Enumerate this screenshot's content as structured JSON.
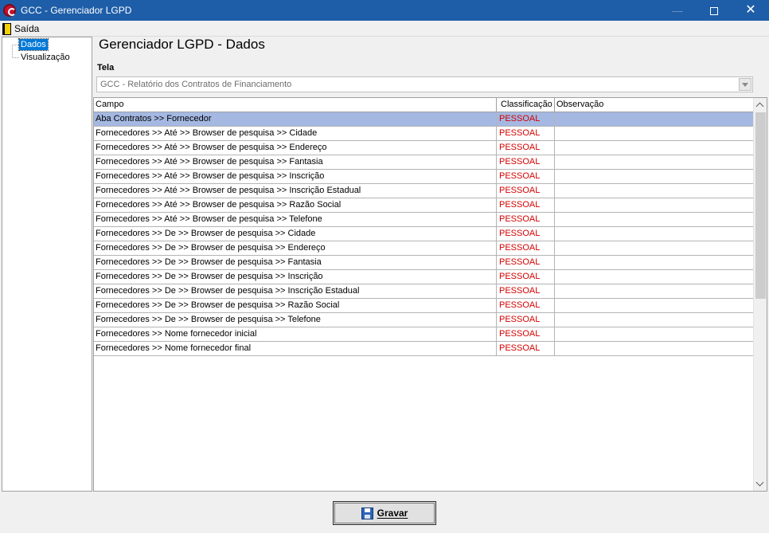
{
  "window": {
    "title": "GCC - Gerenciador LGPD"
  },
  "menu": {
    "exit_label": "Saída"
  },
  "tree": {
    "items": [
      {
        "label": "Dados",
        "selected": true
      },
      {
        "label": "Visualização",
        "selected": false
      }
    ]
  },
  "page": {
    "heading": "Gerenciador LGPD - Dados",
    "tela_label": "Tela",
    "tela_value": "GCC - Relatório dos Contratos de Financiamento"
  },
  "grid": {
    "columns": {
      "campo": "Campo",
      "classificacao": "Classificação",
      "observacao": "Observação"
    },
    "rows": [
      {
        "campo": "Aba Contratos >> Fornecedor",
        "classificacao": "PESSOAL",
        "observacao": ""
      },
      {
        "campo": "Fornecedores >> Até >> Browser de pesquisa >> Cidade",
        "classificacao": "PESSOAL",
        "observacao": ""
      },
      {
        "campo": "Fornecedores >> Até >> Browser de pesquisa >> Endereço",
        "classificacao": "PESSOAL",
        "observacao": ""
      },
      {
        "campo": "Fornecedores >> Até >> Browser de pesquisa >> Fantasia",
        "classificacao": "PESSOAL",
        "observacao": ""
      },
      {
        "campo": "Fornecedores >> Até >> Browser de pesquisa >> Inscrição",
        "classificacao": "PESSOAL",
        "observacao": ""
      },
      {
        "campo": "Fornecedores >> Até >> Browser de pesquisa >> Inscrição Estadual",
        "classificacao": "PESSOAL",
        "observacao": ""
      },
      {
        "campo": "Fornecedores >> Até >> Browser de pesquisa >> Razão Social",
        "classificacao": "PESSOAL",
        "observacao": ""
      },
      {
        "campo": "Fornecedores >> Até >> Browser de pesquisa >> Telefone",
        "classificacao": "PESSOAL",
        "observacao": ""
      },
      {
        "campo": "Fornecedores >> De >> Browser de pesquisa >> Cidade",
        "classificacao": "PESSOAL",
        "observacao": ""
      },
      {
        "campo": "Fornecedores >> De >> Browser de pesquisa >> Endereço",
        "classificacao": "PESSOAL",
        "observacao": ""
      },
      {
        "campo": "Fornecedores >> De >> Browser de pesquisa >> Fantasia",
        "classificacao": "PESSOAL",
        "observacao": ""
      },
      {
        "campo": "Fornecedores >> De >> Browser de pesquisa >> Inscrição",
        "classificacao": "PESSOAL",
        "observacao": ""
      },
      {
        "campo": "Fornecedores >> De >> Browser de pesquisa >> Inscrição Estadual",
        "classificacao": "PESSOAL",
        "observacao": ""
      },
      {
        "campo": "Fornecedores >> De >> Browser de pesquisa >> Razão Social",
        "classificacao": "PESSOAL",
        "observacao": ""
      },
      {
        "campo": "Fornecedores >> De >> Browser de pesquisa >> Telefone",
        "classificacao": "PESSOAL",
        "observacao": ""
      },
      {
        "campo": "Fornecedores >> Nome fornecedor inicial",
        "classificacao": "PESSOAL",
        "observacao": ""
      },
      {
        "campo": "Fornecedores >> Nome fornecedor final",
        "classificacao": "PESSOAL",
        "observacao": ""
      }
    ],
    "selected_row": 0
  },
  "footer": {
    "save_label": "Gravar"
  },
  "colors": {
    "titlebar": "#1e5ea8",
    "selection": "#a4b8e2",
    "classification": "#d40000"
  }
}
